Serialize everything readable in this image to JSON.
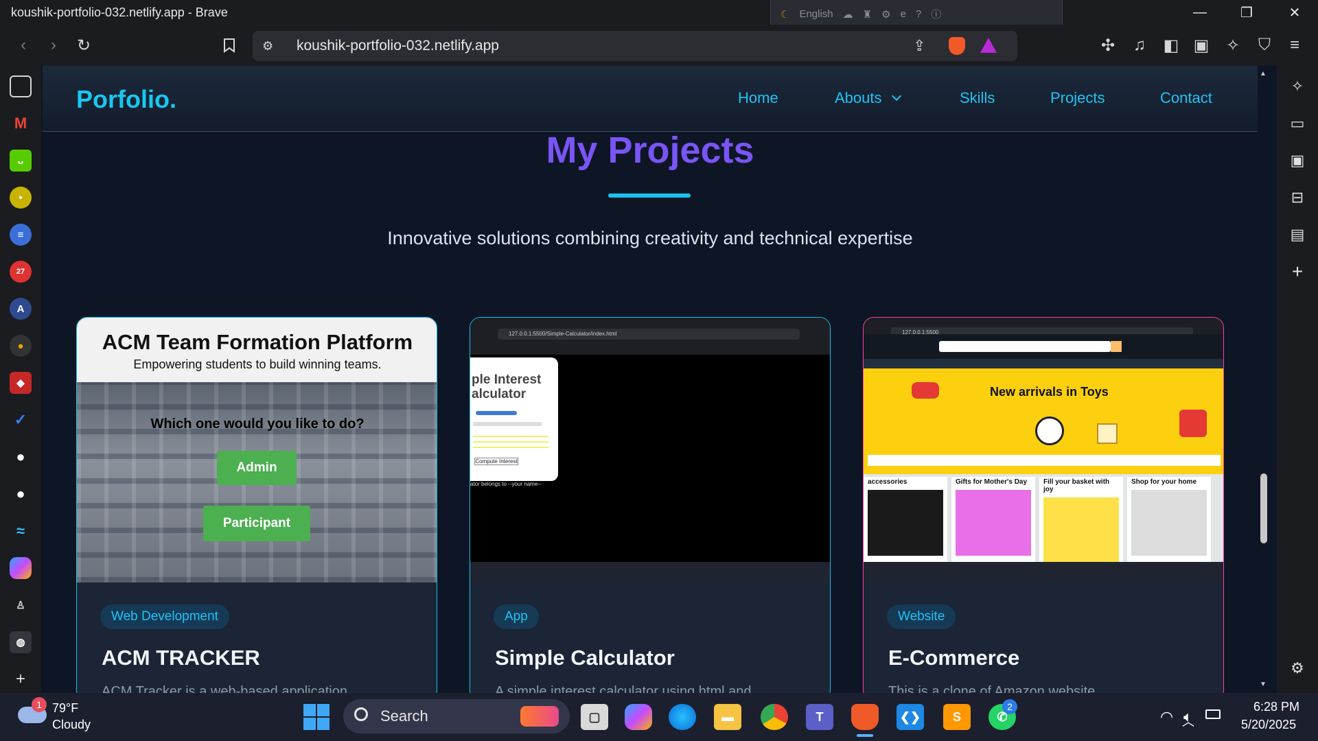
{
  "browser": {
    "window_title": "koushik-portfolio-032.netlify.app - Brave",
    "tray_language": "English",
    "url": "koushik-portfolio-032.netlify.app"
  },
  "site": {
    "brand": "Porfolio.",
    "nav": [
      "Home",
      "Abouts",
      "Skills",
      "Projects",
      "Contact"
    ],
    "heading": "My Projects",
    "subtitle": "Innovative solutions combining creativity and technical expertise"
  },
  "projects": [
    {
      "tag": "Web Development",
      "title": "ACM TRACKER",
      "desc": "ACM Tracker is a web-based application",
      "border_color": "#18c1f0",
      "shot": {
        "heading": "ACM Team Formation Platform",
        "tagline": "Empowering students to build winning teams.",
        "question": "Which one would you like to do?",
        "buttons": [
          "Admin",
          "Participant"
        ]
      }
    },
    {
      "tag": "App",
      "title": "Simple Calculator",
      "desc": "A simple interest calculator using html and",
      "border_color": "#18c1f0",
      "shot": {
        "url": "127.0.0.1:5500/Simple-Calculator/index.html",
        "calc_title": "ple Interest alculator",
        "compute_label": "Compute Interest",
        "footer": "ator belongs to --your name--"
      }
    },
    {
      "tag": "Website",
      "title": "E-Commerce",
      "desc": "This is a clone of Amazon website",
      "border_color": "#ff3fa4",
      "shot": {
        "url": "127.0.0.1:5500",
        "banner": "New arrivals in Toys",
        "tiles": [
          "accessories",
          "Gifts for Mother's Day",
          "Fill your basket with joy",
          "Shop for your home"
        ]
      }
    }
  ],
  "taskbar": {
    "weather_temp": "79°F",
    "weather_desc": "Cloudy",
    "weather_badge": "1",
    "search": "Search",
    "whatsapp_badge": "2",
    "time": "6:28 PM",
    "date": "5/20/2025"
  }
}
